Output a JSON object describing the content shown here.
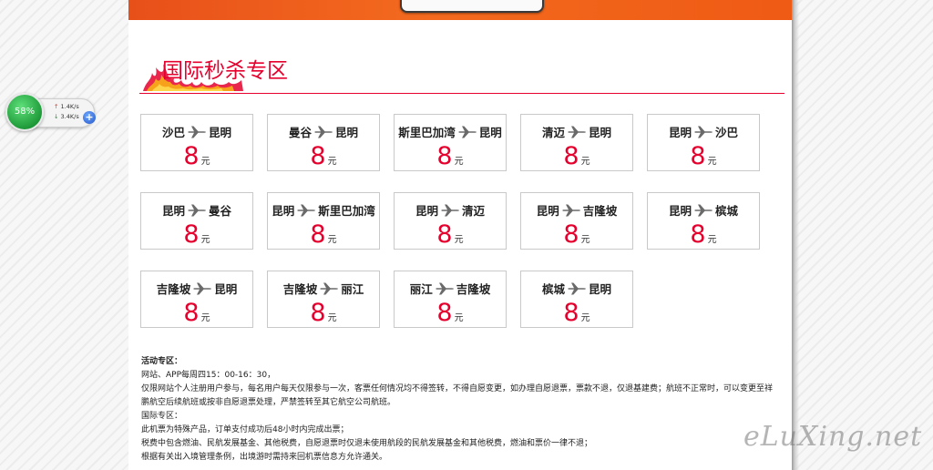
{
  "section": {
    "title": "国际秒杀专区"
  },
  "price_unit": "元",
  "routes": [
    {
      "from": "沙巴",
      "to": "昆明",
      "price": "8"
    },
    {
      "from": "曼谷",
      "to": "昆明",
      "price": "8"
    },
    {
      "from": "斯里巴加湾",
      "to": "昆明",
      "price": "8"
    },
    {
      "from": "清迈",
      "to": "昆明",
      "price": "8"
    },
    {
      "from": "昆明",
      "to": "沙巴",
      "price": "8"
    },
    {
      "from": "昆明",
      "to": "曼谷",
      "price": "8"
    },
    {
      "from": "昆明",
      "to": "斯里巴加湾",
      "price": "8"
    },
    {
      "from": "昆明",
      "to": "清迈",
      "price": "8"
    },
    {
      "from": "昆明",
      "to": "吉隆坡",
      "price": "8"
    },
    {
      "from": "昆明",
      "to": "槟城",
      "price": "8"
    },
    {
      "from": "吉隆坡",
      "to": "昆明",
      "price": "8"
    },
    {
      "from": "吉隆坡",
      "to": "丽江",
      "price": "8"
    },
    {
      "from": "丽江",
      "to": "吉隆坡",
      "price": "8"
    },
    {
      "from": "槟城",
      "to": "昆明",
      "price": "8"
    }
  ],
  "notes": [
    {
      "text": "活动专区：",
      "bold": true
    },
    {
      "text": "网站、APP每周四15：00-16：30，",
      "bold": false
    },
    {
      "text": "仅限网站个人注册用户参与，每名用户每天仅限参与一次，客票任何情况均不得签转，不得自愿变更，如办理自愿退票，票款不退，仅退基建费；航班不正常时，可以变更至祥鹏航空后续航班或按非自愿退票处理，严禁签转至其它航空公司航班。",
      "bold": false
    },
    {
      "text": "国际专区：",
      "bold": false
    },
    {
      "text": "此机票为特殊产品，订单支付成功后48小时内完成出票；",
      "bold": false
    },
    {
      "text": "税费中包含燃油、民航发展基金、其他税费，自愿退票时仅退未使用航段的民航发展基金和其他税费，燃油和票价一律不退；",
      "bold": false
    },
    {
      "text": "根据有关出入境管理条例，出境游时需持来回机票信息方允许通关。",
      "bold": false
    }
  ],
  "widget": {
    "percent": "58%",
    "upload": "1.4K/s",
    "download": "3.4K/s",
    "plus": "+"
  },
  "watermark": "eLuXing.net",
  "colors": {
    "accent": "#e5002d",
    "banner": "#f36a1e"
  },
  "icons": {
    "route_separator": "plane-icon",
    "header_decoration": "flame-icon"
  }
}
